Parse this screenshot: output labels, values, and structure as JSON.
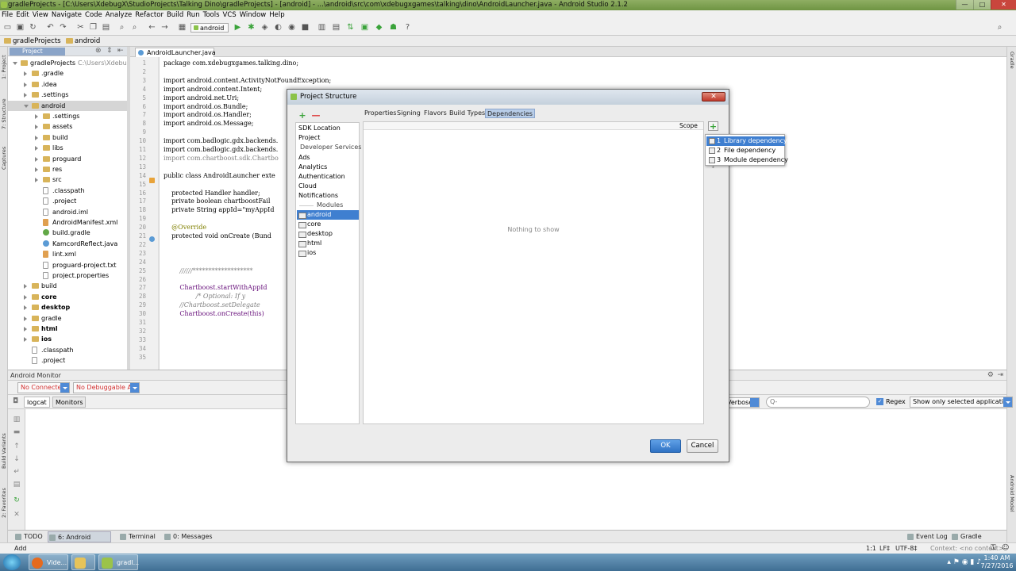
{
  "window": {
    "title": "gradleProjects - [C:\\Users\\XdebugX\\StudioProjects\\Talking Dino\\gradleProjects] - [android] - ...\\android\\src\\com\\xdebugxgames\\talking\\dino\\AndroidLauncher.java - Android Studio 2.1.2",
    "minimize": "—",
    "maximize": "□",
    "close": "✕"
  },
  "menu": [
    "File",
    "Edit",
    "View",
    "Navigate",
    "Code",
    "Analyze",
    "Refactor",
    "Build",
    "Run",
    "Tools",
    "VCS",
    "Window",
    "Help"
  ],
  "toolbar": {
    "run_config": "android",
    "help": "?"
  },
  "breadcrumbs": [
    "gradleProjects",
    "android"
  ],
  "left_tabs": [
    "1: Project",
    "7: Structure",
    "Captures",
    "Build Variants",
    "2: Favorites"
  ],
  "right_tabs": [
    "Gradle",
    "Android Model"
  ],
  "project_panel": {
    "tab": "Project"
  },
  "tree": [
    {
      "label": "gradleProjects",
      "suffix": "C:\\Users\\XdebugX",
      "indent": 0,
      "kind": "folder",
      "open": true
    },
    {
      "label": ".gradle",
      "indent": 1,
      "kind": "folder"
    },
    {
      "label": ".idea",
      "indent": 1,
      "kind": "folder"
    },
    {
      "label": ".settings",
      "indent": 1,
      "kind": "folder"
    },
    {
      "label": "android",
      "indent": 1,
      "kind": "folder",
      "open": true,
      "selected": true
    },
    {
      "label": ".settings",
      "indent": 2,
      "kind": "folder"
    },
    {
      "label": "assets",
      "indent": 2,
      "kind": "folder"
    },
    {
      "label": "build",
      "indent": 2,
      "kind": "folder"
    },
    {
      "label": "libs",
      "indent": 2,
      "kind": "folder"
    },
    {
      "label": "proguard",
      "indent": 2,
      "kind": "folder"
    },
    {
      "label": "res",
      "indent": 2,
      "kind": "folder"
    },
    {
      "label": "src",
      "indent": 2,
      "kind": "folder"
    },
    {
      "label": ".classpath",
      "indent": 2,
      "kind": "file",
      "leaf": true
    },
    {
      "label": ".project",
      "indent": 2,
      "kind": "file",
      "leaf": true
    },
    {
      "label": "android.iml",
      "indent": 2,
      "kind": "file",
      "leaf": true
    },
    {
      "label": "AndroidManifest.xml",
      "indent": 2,
      "kind": "xml",
      "leaf": true
    },
    {
      "label": "build.gradle",
      "indent": 2,
      "kind": "green",
      "leaf": true
    },
    {
      "label": "KamcordReflect.java",
      "indent": 2,
      "kind": "java",
      "leaf": true
    },
    {
      "label": "lint.xml",
      "indent": 2,
      "kind": "xml",
      "leaf": true
    },
    {
      "label": "proguard-project.txt",
      "indent": 2,
      "kind": "file",
      "leaf": true
    },
    {
      "label": "project.properties",
      "indent": 2,
      "kind": "file",
      "leaf": true
    },
    {
      "label": "build",
      "indent": 1,
      "kind": "folder"
    },
    {
      "label": "core",
      "indent": 1,
      "kind": "folder",
      "bold": true
    },
    {
      "label": "desktop",
      "indent": 1,
      "kind": "folder",
      "bold": true
    },
    {
      "label": "gradle",
      "indent": 1,
      "kind": "folder"
    },
    {
      "label": "html",
      "indent": 1,
      "kind": "folder",
      "bold": true
    },
    {
      "label": "ios",
      "indent": 1,
      "kind": "folder",
      "bold": true
    },
    {
      "label": ".classpath",
      "indent": 1,
      "kind": "file",
      "leaf": true
    },
    {
      "label": ".project",
      "indent": 1,
      "kind": "file",
      "leaf": true
    }
  ],
  "editor": {
    "tab": "AndroidLauncher.java",
    "lines": [
      {
        "n": "1",
        "t": "package com.xdebugxgames.talking.dino;",
        "s": "pkg"
      },
      {
        "n": "2",
        "t": ""
      },
      {
        "n": "3",
        "t": "import android.content.ActivityNotFoundException;",
        "s": "imp"
      },
      {
        "n": "4",
        "t": "import android.content.Intent;",
        "s": "imp"
      },
      {
        "n": "5",
        "t": "import android.net.Uri;",
        "s": "imp"
      },
      {
        "n": "6",
        "t": "import android.os.Bundle;",
        "s": "imp"
      },
      {
        "n": "7",
        "t": "import android.os.Handler;",
        "s": "imp"
      },
      {
        "n": "8",
        "t": "import android.os.Message;",
        "s": "imp"
      },
      {
        "n": "9",
        "t": ""
      },
      {
        "n": "10",
        "t": "import com.badlogic.gdx.backends.",
        "s": "imp"
      },
      {
        "n": "11",
        "t": "import com.badlogic.gdx.backends.",
        "s": "imp"
      },
      {
        "n": "12",
        "t": "import com.chartboost.sdk.Chartbo",
        "s": "impg"
      },
      {
        "n": "13",
        "t": ""
      },
      {
        "n": "14",
        "t": "public class AndroidLauncher exte",
        "s": "cls"
      },
      {
        "n": "15",
        "t": ""
      },
      {
        "n": "16",
        "t": "    protected Handler handler;",
        "s": "fld"
      },
      {
        "n": "17",
        "t": "    private boolean chartboostFail",
        "s": "fld"
      },
      {
        "n": "18",
        "t": "    private String appId=\"myAppId",
        "s": "fld"
      },
      {
        "n": "19",
        "t": ""
      },
      {
        "n": "20",
        "t": "    @Override",
        "s": "ann"
      },
      {
        "n": "21",
        "t": "    protected void onCreate (Bund",
        "s": "fld"
      },
      {
        "n": "22",
        "t": ""
      },
      {
        "n": "23",
        "t": ""
      },
      {
        "n": "24",
        "t": ""
      },
      {
        "n": "25",
        "t": "        //////*******************",
        "s": "cmt"
      },
      {
        "n": "26",
        "t": ""
      },
      {
        "n": "27",
        "t": "        Chartboost.startWithAppId",
        "s": "cb"
      },
      {
        "n": "28",
        "t": "                /* Optional: If y",
        "s": "cmt"
      },
      {
        "n": "29",
        "t": "        //Chartboost.setDelegate",
        "s": "cmt"
      },
      {
        "n": "30",
        "t": "        Chartboost.onCreate(this)",
        "s": "cb"
      },
      {
        "n": "31",
        "t": ""
      },
      {
        "n": "32",
        "t": ""
      },
      {
        "n": "33",
        "t": ""
      },
      {
        "n": "34",
        "t": ""
      },
      {
        "n": "35",
        "t": ""
      }
    ]
  },
  "monitor": {
    "header": "Android Monitor",
    "device_combo": "No Connected",
    "process_combo": "No Debuggable A",
    "tabs": [
      "logcat",
      "Monitors"
    ],
    "log_level": "Verbose",
    "search_placeholder": "Q-",
    "regex_label": "Regex",
    "filter": "Show only selected application"
  },
  "bottom_tabs": [
    "TODO",
    "6: Android Monitor",
    "Terminal",
    "0: Messages"
  ],
  "bottom_right_tabs": [
    "Event Log",
    "Gradle Console"
  ],
  "status": {
    "left": "Add",
    "position": "1:1",
    "line_sep": "LF‡",
    "encoding": "UTF-8‡",
    "context": "Context: <no context>"
  },
  "taskbar": {
    "items": [
      "Vide...",
      "",
      "gradl..."
    ],
    "time": "1:40 AM",
    "date": "7/27/2016"
  },
  "dialog": {
    "title": "Project Structure",
    "close": "✕",
    "add": "+",
    "remove": "—",
    "sidebar": {
      "sdk_location": "SDK Location",
      "project": "Project",
      "developer_services": "Developer Services",
      "services": [
        "Ads",
        "Analytics",
        "Authentication",
        "Cloud",
        "Notifications"
      ],
      "modules_header": "Modules",
      "modules": [
        "android",
        "core",
        "desktop",
        "html",
        "ios"
      ],
      "selected_module": "android"
    },
    "tabs": [
      "Properties",
      "Signing",
      "Flavors",
      "Build Types",
      "Dependencies"
    ],
    "active_tab": "Dependencies",
    "scope_header": "Scope",
    "empty_text": "Nothing to show",
    "add_dependency": "+",
    "ok": "OK",
    "cancel": "Cancel"
  },
  "popup": [
    {
      "num": "1",
      "label": "Library dependency",
      "selected": true
    },
    {
      "num": "2",
      "label": "File dependency"
    },
    {
      "num": "3",
      "label": "Module dependency"
    }
  ],
  "colors": {
    "accent": "#3f7fd0",
    "keyword": "#000080",
    "string": "#008000",
    "error": "#d32f2f"
  }
}
